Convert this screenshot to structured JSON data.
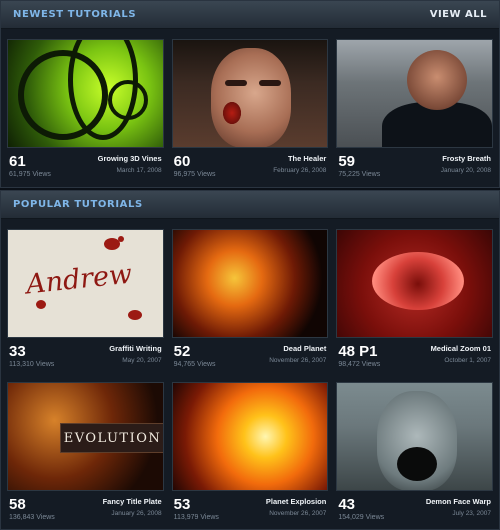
{
  "newest": {
    "heading": "NEWEST TUTORIALS",
    "view_all": "VIEW ALL",
    "items": [
      {
        "number": "61",
        "title": "Growing 3D Vines",
        "views": "61,975 Views",
        "date": "March 17, 2008",
        "thumb_icon": "green-vines-image"
      },
      {
        "number": "60",
        "title": "The Healer",
        "views": "96,975 Views",
        "date": "February 26, 2008",
        "thumb_icon": "wounded-face-image"
      },
      {
        "number": "59",
        "title": "Frosty Breath",
        "views": "75,225 Views",
        "date": "January 20, 2008",
        "thumb_icon": "man-outdoors-image"
      }
    ]
  },
  "popular": {
    "heading": "POPULAR TUTORIALS",
    "items": [
      {
        "number": "33",
        "title": "Graffiti Writing",
        "views": "113,310 Views",
        "date": "May 20, 2007",
        "thumb_text": "Andrew",
        "thumb_icon": "graffiti-image"
      },
      {
        "number": "52",
        "title": "Dead Planet",
        "views": "94,765 Views",
        "date": "November 26, 2007",
        "thumb_icon": "burning-planet-image"
      },
      {
        "number": "48 P1",
        "title": "Medical Zoom 01",
        "views": "98,472 Views",
        "date": "October 1, 2007",
        "thumb_icon": "blood-cell-image"
      },
      {
        "number": "58",
        "title": "Fancy Title Plate",
        "views": "136,843 Views",
        "date": "January 26, 2008",
        "thumb_text": "EVOLUTION",
        "thumb_icon": "title-plate-image"
      },
      {
        "number": "53",
        "title": "Planet Explosion",
        "views": "113,979 Views",
        "date": "November 26, 2007",
        "thumb_icon": "explosion-image"
      },
      {
        "number": "43",
        "title": "Demon Face Warp",
        "views": "154,029 Views",
        "date": "July 23, 2007",
        "thumb_icon": "screaming-face-image"
      }
    ]
  }
}
